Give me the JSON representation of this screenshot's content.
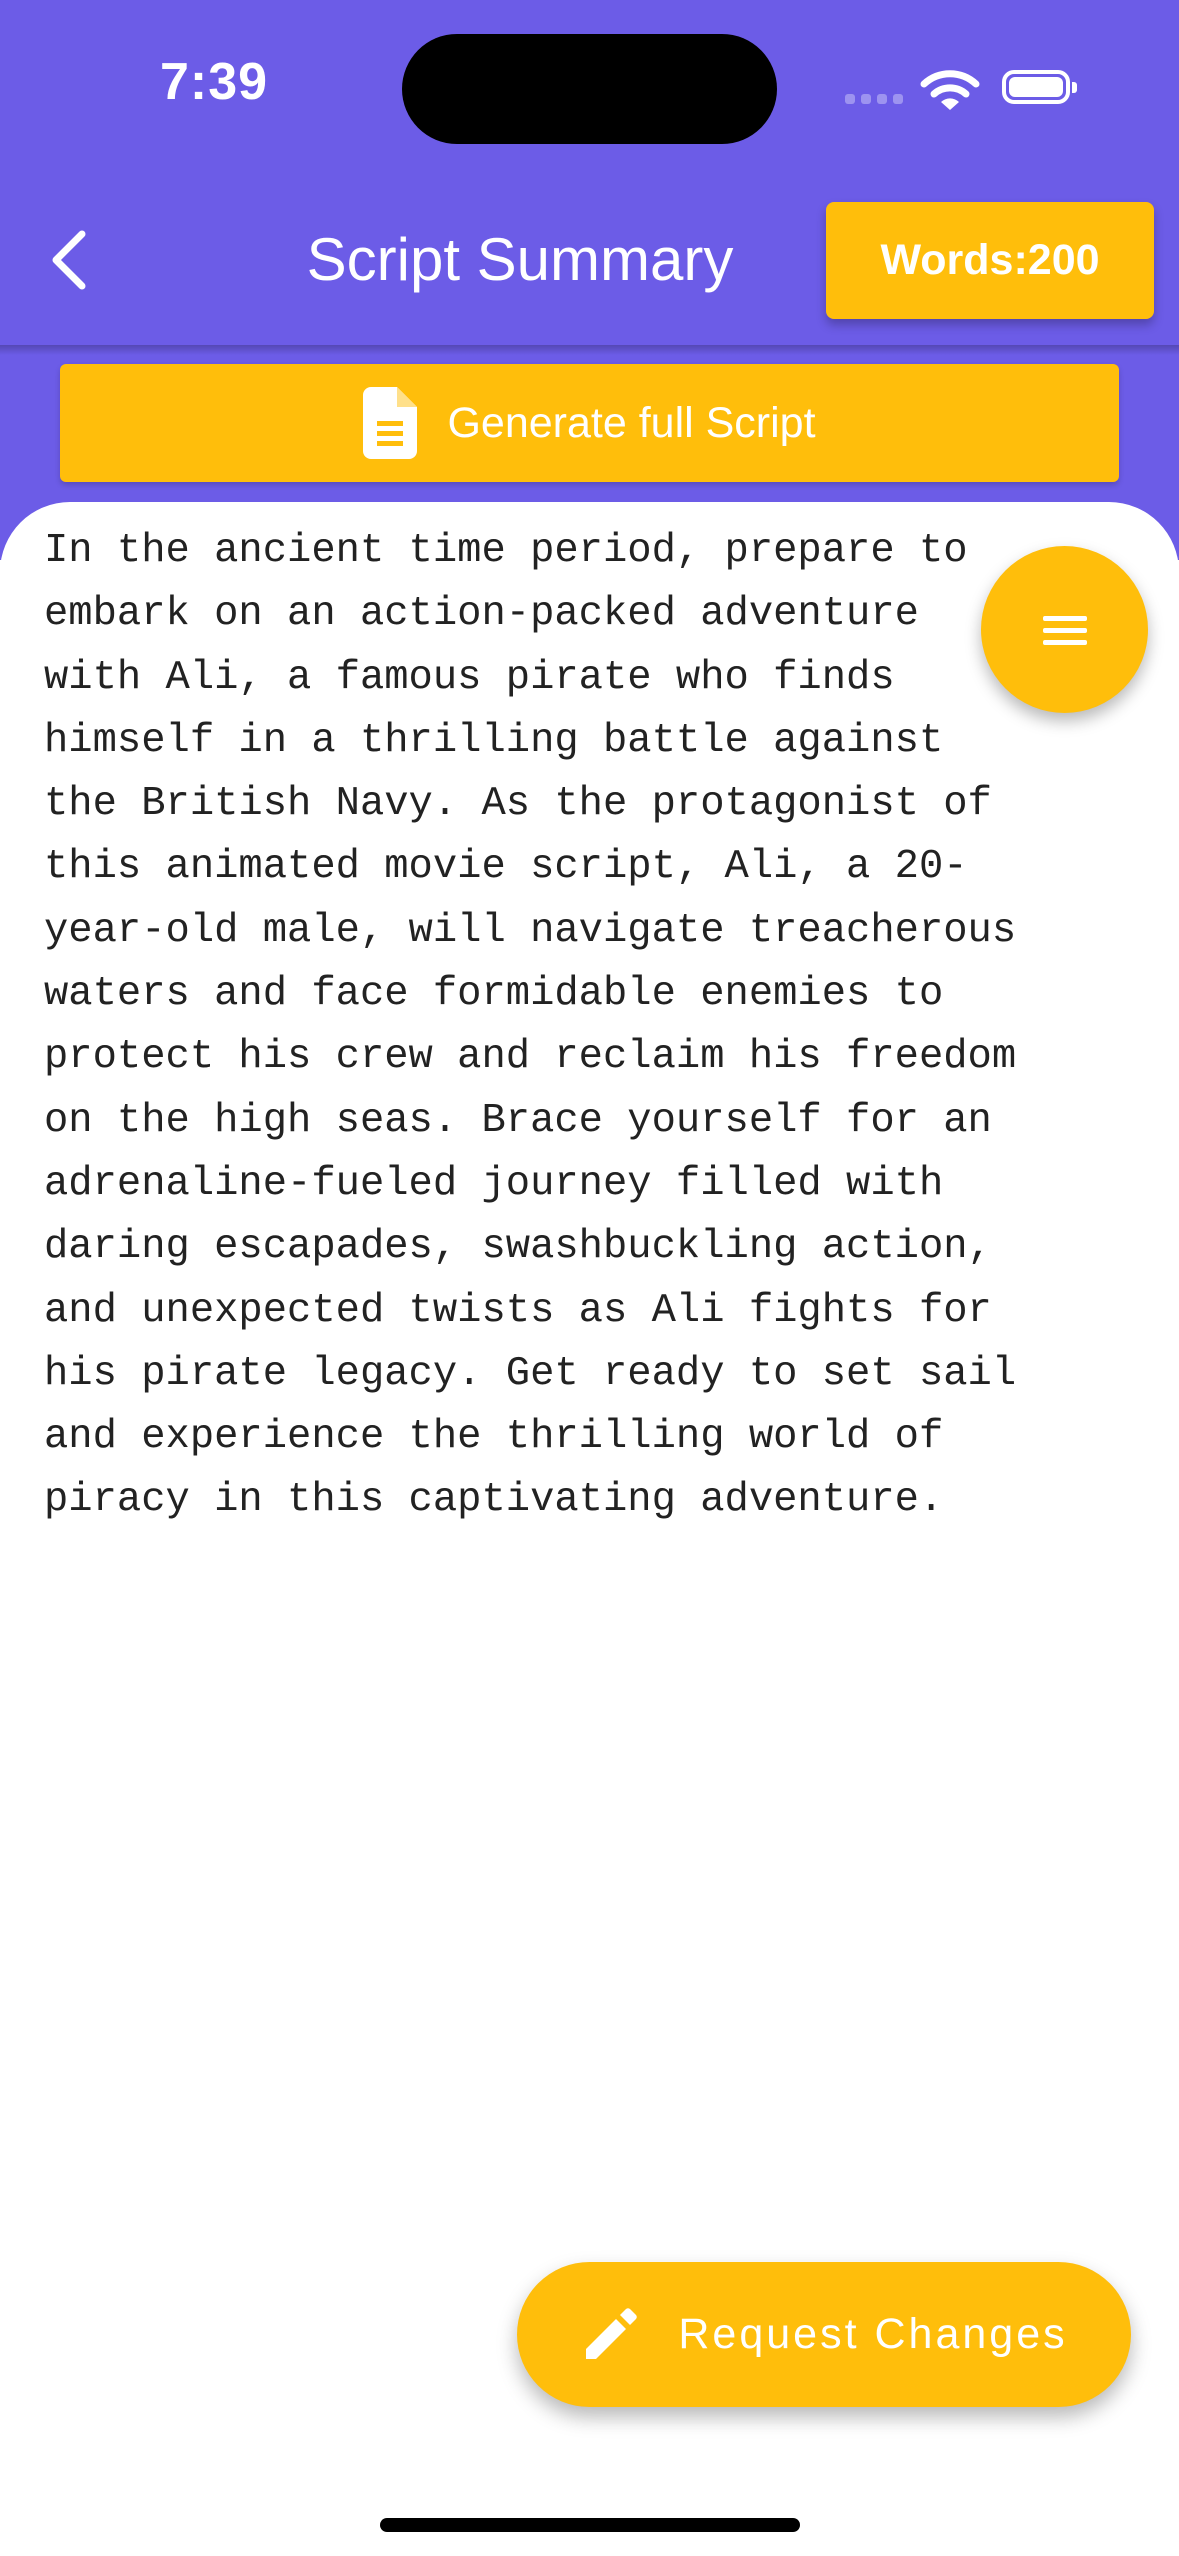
{
  "status_bar": {
    "time": "7:39",
    "icons": [
      "signal-icon",
      "wifi-icon",
      "battery-icon"
    ]
  },
  "app_bar": {
    "title": "Script Summary",
    "back_icon": "chevron-left-icon",
    "word_count_label": "Words:200"
  },
  "actions": {
    "generate_label": "Generate full Script",
    "generate_icon": "document-icon",
    "request_changes_label": "Request Changes",
    "request_changes_icon": "pencil-icon",
    "menu_icon": "menu-icon"
  },
  "summary": {
    "text": "In the ancient time period, prepare to embark on an action-packed adventure with Ali, a famous pirate who finds himself in a thrilling battle against the British Navy. As the protagonist of this animated movie script, Ali, a 20-year-old male, will navigate treacherous waters and face formidable enemies to protect his crew and reclaim his freedom on the high seas. Brace yourself for an adrenaline-fueled journey filled with daring escapades, swashbuckling action, and unexpected twists as Ali fights for his pirate legacy. Get ready to set sail and experience the thrilling world of piracy in this captivating adventure."
  },
  "colors": {
    "primary": "#6c5ce7",
    "accent": "#ffbe0b",
    "text": "#222222",
    "on_accent": "#ffffff"
  }
}
